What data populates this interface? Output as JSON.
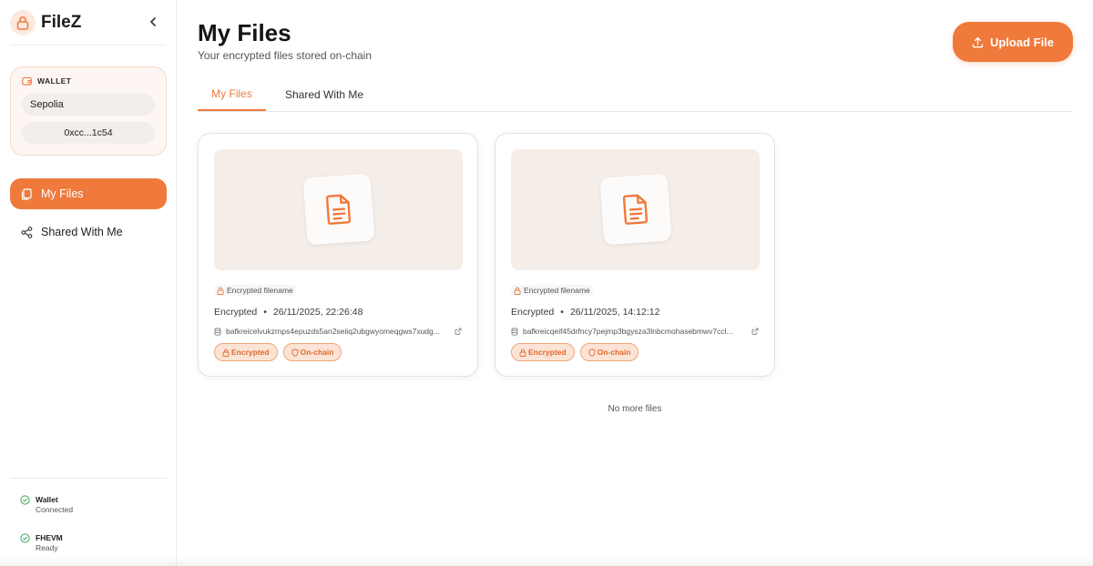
{
  "brand": {
    "name": "FileZ"
  },
  "wallet": {
    "heading": "WALLET",
    "network": "Sepolia",
    "address": "0xcc...1c54"
  },
  "sidebar": {
    "items": [
      {
        "label": "My Files",
        "icon": "files-icon",
        "active": true
      },
      {
        "label": "Shared With Me",
        "icon": "share-icon",
        "active": false
      }
    ]
  },
  "status": [
    {
      "title": "Wallet",
      "subtitle": "Connected"
    },
    {
      "title": "FHEVM",
      "subtitle": "Ready"
    }
  ],
  "header": {
    "title": "My Files",
    "subtitle": "Your encrypted files stored on-chain",
    "upload_label": "Upload File"
  },
  "tabs": [
    {
      "label": "My Files",
      "active": true
    },
    {
      "label": "Shared With Me",
      "active": false
    }
  ],
  "files": [
    {
      "filename": "Encrypted filename",
      "state": "Encrypted",
      "separator": "•",
      "date": "26/11/2025, 22:26:48",
      "cid": "bafkreicelvukzrnps4epuzds5an2seiiq2ubgwyomeqgws7xudg...",
      "badges": [
        "Encrypted",
        "On-chain"
      ]
    },
    {
      "filename": "Encrypted filename",
      "state": "Encrypted",
      "separator": "•",
      "date": "26/11/2025, 14:12:12",
      "cid": "bafkreicqeif45drfncy7pejmp3bgysza3lnbcmohasebmwv7ccl...",
      "badges": [
        "Encrypted",
        "On-chain"
      ]
    }
  ],
  "footer": {
    "no_more": "No more files"
  },
  "colors": {
    "accent": "#ef7a3c",
    "success": "#3aa55d",
    "badge_bg": "#fbe3d6"
  }
}
